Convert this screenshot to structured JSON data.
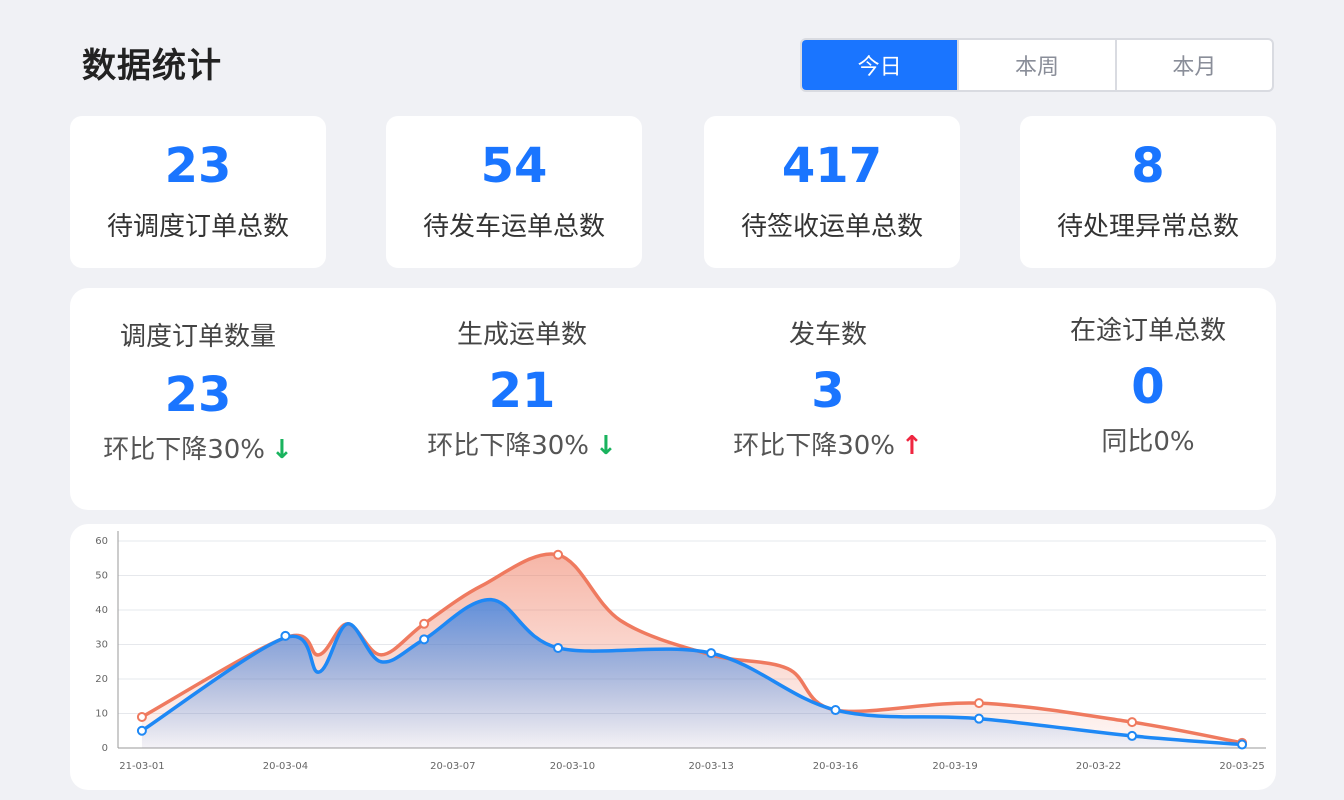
{
  "header": {
    "title": "数据统计",
    "tabs": [
      {
        "label": "今日",
        "active": true
      },
      {
        "label": "本周",
        "active": false
      },
      {
        "label": "本月",
        "active": false
      }
    ]
  },
  "cards": [
    {
      "value": "23",
      "label": "待调度订单总数"
    },
    {
      "value": "54",
      "label": "待发车运单总数"
    },
    {
      "value": "417",
      "label": "待签收运单总数"
    },
    {
      "value": "8",
      "label": "待处理异常总数"
    }
  ],
  "stats": [
    {
      "label": "调度订单数量",
      "value": "23",
      "compare": "环比下降30%",
      "arrow": "down"
    },
    {
      "label": "生成运单数",
      "value": "21",
      "compare": "环比下降30%",
      "arrow": "down"
    },
    {
      "label": "发车数",
      "value": "3",
      "compare": "环比下降30%",
      "arrow": "up"
    },
    {
      "label": "在途订单总数",
      "value": "0",
      "compare": "同比0%",
      "arrow": ""
    }
  ],
  "colors": {
    "accent": "#1a75ff",
    "series_blue": "#1e88f5",
    "series_orange": "#ef7a5f",
    "arrow_down": "#1ab35e",
    "arrow_up": "#ef2640"
  },
  "chart_data": {
    "type": "area",
    "x_ticks": [
      "21-03-01",
      "20-03-04",
      "20-03-07",
      "20-03-10",
      "20-03-13",
      "20-03-16",
      "20-03-19",
      "20-03-22",
      "20-03-25"
    ],
    "y_ticks": [
      0,
      10,
      20,
      30,
      40,
      50,
      60
    ],
    "ylim": [
      0,
      60
    ],
    "xlim": [
      0,
      24
    ],
    "grid": true,
    "series": [
      {
        "color": "orange",
        "points": [
          [
            0.5,
            9
          ],
          [
            3.5,
            32
          ],
          [
            4.2,
            27
          ],
          [
            4.8,
            36
          ],
          [
            5.5,
            27
          ],
          [
            6.4,
            36
          ],
          [
            7.6,
            47
          ],
          [
            9.2,
            56
          ],
          [
            10.5,
            37
          ],
          [
            12.4,
            27
          ],
          [
            14,
            23
          ],
          [
            15,
            11
          ],
          [
            18,
            13
          ],
          [
            21.2,
            7.5
          ],
          [
            23.5,
            1.5
          ]
        ],
        "markers": [
          [
            0.5,
            9
          ],
          [
            6.4,
            36
          ],
          [
            9.2,
            56
          ],
          [
            18,
            13
          ],
          [
            21.2,
            7.5
          ],
          [
            23.5,
            1.5
          ]
        ]
      },
      {
        "color": "blue",
        "points": [
          [
            0.5,
            5
          ],
          [
            3.5,
            32
          ],
          [
            4.2,
            22
          ],
          [
            4.8,
            36
          ],
          [
            5.5,
            25
          ],
          [
            6.4,
            31.5
          ],
          [
            7.8,
            43
          ],
          [
            9.2,
            29
          ],
          [
            12.4,
            27.5
          ],
          [
            15,
            11
          ],
          [
            18,
            8.5
          ],
          [
            21.2,
            3.5
          ],
          [
            23.5,
            1
          ]
        ],
        "markers": [
          [
            0.5,
            5
          ],
          [
            3.5,
            32.5
          ],
          [
            6.4,
            31.5
          ],
          [
            9.2,
            29
          ],
          [
            12.4,
            27.5
          ],
          [
            15,
            11
          ],
          [
            18,
            8.5
          ],
          [
            21.2,
            3.5
          ],
          [
            23.5,
            1
          ]
        ]
      }
    ]
  }
}
